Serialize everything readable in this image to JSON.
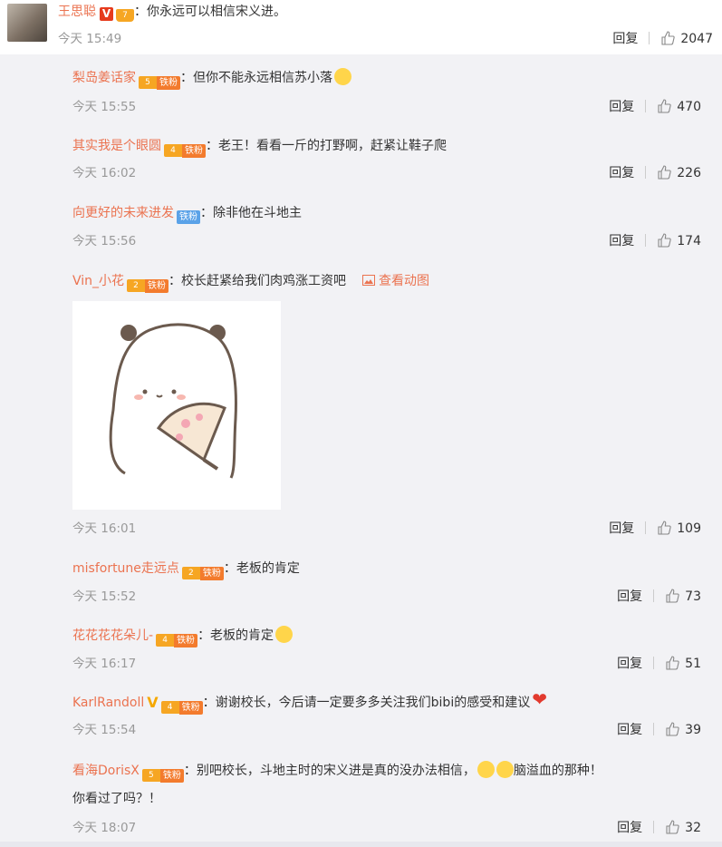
{
  "main_comment": {
    "username": "王思聪",
    "v_badge": "V",
    "level": "7",
    "text": "：你永远可以相信宋义进。",
    "time": "今天 15:49",
    "reply_label": "回复",
    "likes": "2047"
  },
  "replies": [
    {
      "username": "梨岛姜话家",
      "level": "5",
      "fan": "铁粉",
      "text": "：但你不能永远相信苏小落",
      "emoji": "crying-face",
      "time": "今天 15:55",
      "reply_label": "回复",
      "likes": "470"
    },
    {
      "username": "其实我是个眼圆",
      "level": "4",
      "fan": "铁粉",
      "text": "：老王！看看一斤的打野啊，赶紧让鞋子爬",
      "time": "今天 16:02",
      "reply_label": "回复",
      "likes": "226"
    },
    {
      "username": "向更好的未来进发",
      "level": "",
      "fan": "铁粉",
      "text": "：除非他在斗地主",
      "time": "今天 15:56",
      "reply_label": "回复",
      "likes": "174"
    },
    {
      "username": "Vin_小花",
      "level": "2",
      "fan": "铁粉",
      "text": "：校长赶紧给我们肉鸡涨工资吧",
      "view_gif": "查看动图",
      "time": "今天 16:01",
      "reply_label": "回复",
      "likes": "109"
    },
    {
      "username": "misfortune走远点",
      "level": "2",
      "fan": "铁粉",
      "text": "：老板的肯定",
      "time": "今天 15:52",
      "reply_label": "回复",
      "likes": "73"
    },
    {
      "username": "花花花花朵儿-",
      "level": "4",
      "fan": "铁粉",
      "text": "：老板的肯定",
      "emoji": "doge",
      "time": "今天 16:17",
      "reply_label": "回复",
      "likes": "51"
    },
    {
      "username": "KarlRandoll",
      "level": "4",
      "fan": "铁粉",
      "text": "：谢谢校长，今后请一定要多多关注我们bibi的感受和建议",
      "emoji": "heart",
      "time": "今天 15:54",
      "reply_label": "回复",
      "likes": "39"
    },
    {
      "username": "看海DorisX",
      "level": "5",
      "fan": "铁粉",
      "text": "：别吧校长，斗地主时的宋义进是真的没办法相信，",
      "text2": "脑溢血的那种！",
      "text3": "你看过了吗？！",
      "time": "今天 18:07",
      "reply_label": "回复",
      "likes": "32"
    }
  ],
  "colors": {
    "username": "#eb7350",
    "muted": "#999999",
    "background": "#f2f2f5",
    "fan_orange": "#f37b2d",
    "fan_blue": "#5aa2e8"
  }
}
